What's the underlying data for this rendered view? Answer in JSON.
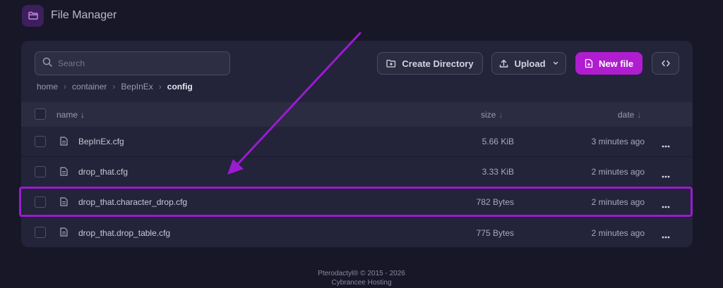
{
  "header": {
    "title": "File Manager",
    "icon": "folder-icon"
  },
  "toolbar": {
    "search_placeholder": "Search",
    "create_directory_label": "Create Directory",
    "upload_label": "Upload",
    "new_file_label": "New file",
    "accent_color": "#b01ccf"
  },
  "breadcrumb": {
    "items": [
      "home",
      "container",
      "BepInEx"
    ],
    "current": "config"
  },
  "table": {
    "columns": {
      "name": "name",
      "size": "size",
      "date": "date"
    },
    "rows": [
      {
        "name": "BepInEx.cfg",
        "size": "5.66 KiB",
        "date": "3 minutes ago"
      },
      {
        "name": "drop_that.cfg",
        "size": "3.33 KiB",
        "date": "2 minutes ago"
      },
      {
        "name": "drop_that.character_drop.cfg",
        "size": "782 Bytes",
        "date": "2 minutes ago"
      },
      {
        "name": "drop_that.drop_table.cfg",
        "size": "775 Bytes",
        "date": "2 minutes ago"
      }
    ]
  },
  "annotation": {
    "color": "#9b1bd0"
  },
  "footer": {
    "line1": "Pterodactyl® © 2015 - 2026",
    "line2": "Cybrancee Hosting"
  }
}
